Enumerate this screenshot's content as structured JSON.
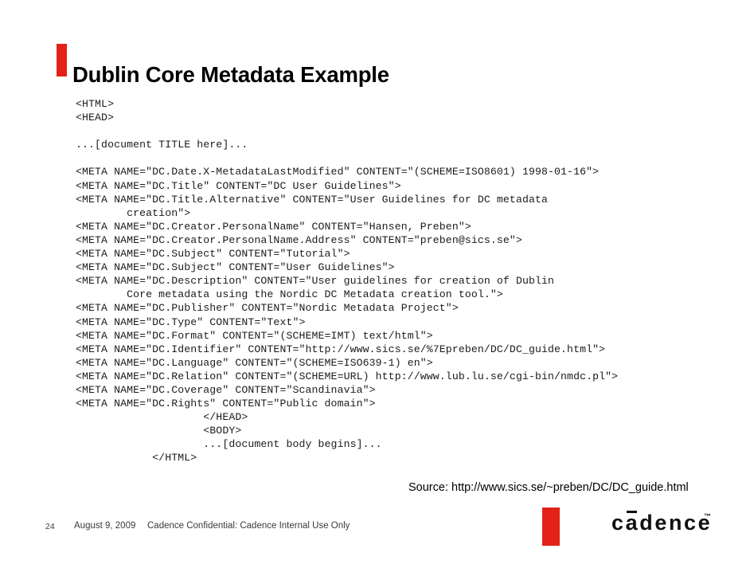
{
  "slide": {
    "title": "Dublin Core Metadata Example",
    "accent_color": "#E32119"
  },
  "code_listing": {
    "lines": [
      "<HTML>",
      "<HEAD>",
      "",
      "...[document TITLE here]...",
      "",
      "<META NAME=\"DC.Date.X-MetadataLastModified\" CONTENT=\"(SCHEME=ISO8601) 1998-01-16\">",
      "<META NAME=\"DC.Title\" CONTENT=\"DC User Guidelines\">",
      "<META NAME=\"DC.Title.Alternative\" CONTENT=\"User Guidelines for DC metadata",
      "        creation\">",
      "<META NAME=\"DC.Creator.PersonalName\" CONTENT=\"Hansen, Preben\">",
      "<META NAME=\"DC.Creator.PersonalName.Address\" CONTENT=\"preben@sics.se\">",
      "<META NAME=\"DC.Subject\" CONTENT=\"Tutorial\">",
      "<META NAME=\"DC.Subject\" CONTENT=\"User Guidelines\">",
      "<META NAME=\"DC.Description\" CONTENT=\"User guidelines for creation of Dublin",
      "        Core metadata using the Nordic DC Metadata creation tool.\">",
      "<META NAME=\"DC.Publisher\" CONTENT=\"Nordic Metadata Project\">",
      "<META NAME=\"DC.Type\" CONTENT=\"Text\">",
      "<META NAME=\"DC.Format\" CONTENT=\"(SCHEME=IMT) text/html\">",
      "<META NAME=\"DC.Identifier\" CONTENT=\"http://www.sics.se/%7Epreben/DC/DC_guide.html\">",
      "<META NAME=\"DC.Language\" CONTENT=\"(SCHEME=ISO639-1) en\">",
      "<META NAME=\"DC.Relation\" CONTENT=\"(SCHEME=URL) http://www.lub.lu.se/cgi-bin/nmdc.pl\">",
      "<META NAME=\"DC.Coverage\" CONTENT=\"Scandinavia\">",
      "<META NAME=\"DC.Rights\" CONTENT=\"Public domain\">",
      "                    </HEAD>",
      "                    <BODY>",
      "                    ...[document body begins]...",
      "            </HTML>"
    ]
  },
  "source_credit": {
    "text": "Source: http://www.sics.se/~preben/DC/DC_guide.html"
  },
  "footer": {
    "slide_number": "24",
    "date": "August 9, 2009",
    "confidentiality": "Cadence Confidential: Cadence Internal Use Only"
  },
  "logo": {
    "word_before": "c",
    "word_macron_letter": "a",
    "word_after": "dence",
    "trademark": "™",
    "bar_color": "#E32119"
  }
}
